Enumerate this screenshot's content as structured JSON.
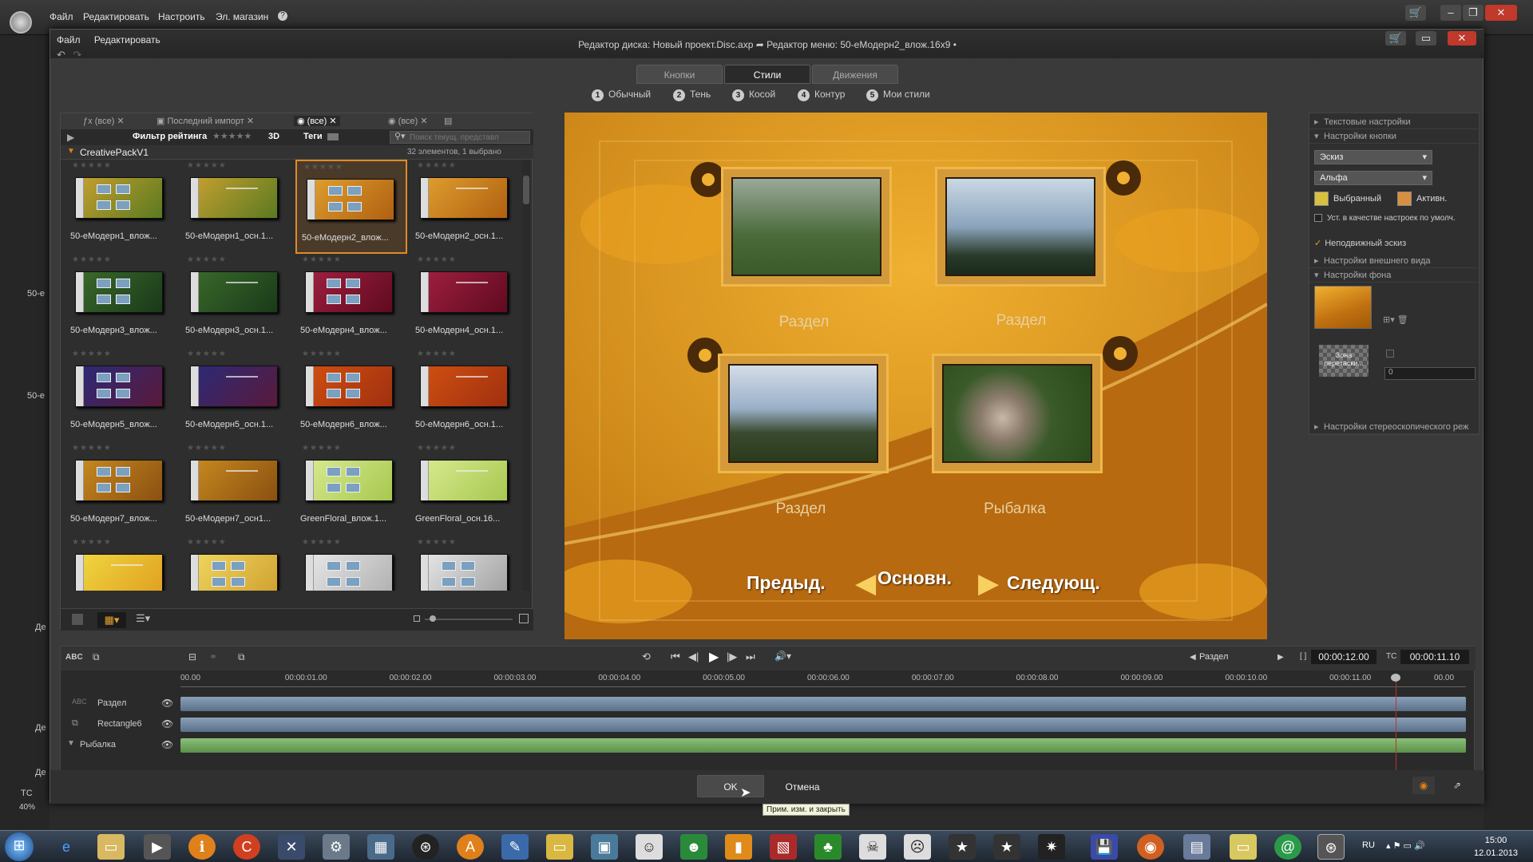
{
  "outer_menu": {
    "file": "Файл",
    "edit": "Редактировать",
    "setup": "Настроить",
    "store": "Эл. магазин",
    "help": "?"
  },
  "dialog": {
    "menu": {
      "file": "Файл",
      "edit": "Редактировать"
    },
    "caption": "Редактор диска: Новый проект.Disc.axp  ➦  Редактор меню: 50-еМодерн2_влож.16х9  •",
    "tabs": [
      "Кнопки",
      "Стили",
      "Движения"
    ],
    "active_tab": "Стили",
    "styles": [
      {
        "num": "1",
        "label": "Обычный"
      },
      {
        "num": "2",
        "label": "Тень"
      },
      {
        "num": "3",
        "label": "Косой"
      },
      {
        "num": "4",
        "label": "Контур"
      },
      {
        "num": "5",
        "label": "Мои стили"
      }
    ]
  },
  "browser": {
    "tabs": [
      "(все)",
      "Последний импорт",
      "(все)",
      "(все)"
    ],
    "filter_label": "Фильтр рейтинга",
    "filter_3d": "3D",
    "filter_tags": "Теги",
    "search_placeholder": "Поиск текущ. представл",
    "group_name": "CreativePackV1",
    "group_count": "32 элементов, 1 выбрано",
    "items": [
      {
        "label": "50-еМодерн1_влож...",
        "color1": "#c8a030",
        "color2": "#5a7a20",
        "type": "grid"
      },
      {
        "label": "50-еМодерн1_осн.1...",
        "color1": "#c8a030",
        "color2": "#5a7a20",
        "type": "text"
      },
      {
        "label": "50-еМодерн2_влож...",
        "color1": "#e0a030",
        "color2": "#b06010",
        "type": "grid"
      },
      {
        "label": "50-еМодерн2_осн.1...",
        "color1": "#e0a030",
        "color2": "#b06010",
        "type": "text"
      },
      {
        "label": "50-еМодерн3_влож...",
        "color1": "#3a6a2a",
        "color2": "#1a3a1a",
        "type": "grid"
      },
      {
        "label": "50-еМодерн3_осн.1...",
        "color1": "#3a6a2a",
        "color2": "#1a3a1a",
        "type": "text"
      },
      {
        "label": "50-еМодерн4_влож...",
        "color1": "#a02040",
        "color2": "#600a20",
        "type": "grid"
      },
      {
        "label": "50-еМодерн4_осн.1...",
        "color1": "#a02040",
        "color2": "#600a20",
        "type": "text"
      },
      {
        "label": "50-еМодерн5_влож...",
        "color1": "#2a2a7a",
        "color2": "#5a1a3a",
        "type": "grid"
      },
      {
        "label": "50-еМодерн5_осн.1...",
        "color1": "#2a2a7a",
        "color2": "#5a1a3a",
        "type": "text"
      },
      {
        "label": "50-еМодерн6_влож...",
        "color1": "#d05010",
        "color2": "#a03010",
        "type": "grid"
      },
      {
        "label": "50-еМодерн6_осн.1...",
        "color1": "#d05010",
        "color2": "#a03010",
        "type": "text"
      },
      {
        "label": "50-еМодерн7_влож...",
        "color1": "#c88a20",
        "color2": "#8a5010",
        "type": "grid"
      },
      {
        "label": "50-еМодерн7_осн1...",
        "color1": "#c88a20",
        "color2": "#8a5010",
        "type": "text"
      },
      {
        "label": "GreenFloral_влож.1...",
        "color1": "#d8ea90",
        "color2": "#a8c850",
        "type": "grid"
      },
      {
        "label": "GreenFloral_осн.16...",
        "color1": "#d8ea90",
        "color2": "#a8c850",
        "type": "text"
      },
      {
        "label": "",
        "color1": "#f0d840",
        "color2": "#e0a020",
        "type": "text"
      },
      {
        "label": "",
        "color1": "#f0d860",
        "color2": "#d0a030",
        "type": "grid"
      },
      {
        "label": "",
        "color1": "#e8e8e8",
        "color2": "#b0b0b0",
        "type": "grid"
      },
      {
        "label": "",
        "color1": "#e8e8e8",
        "color2": "#a0a0a0",
        "type": "grid"
      }
    ]
  },
  "preview": {
    "sections": [
      "Раздел",
      "Раздел",
      "Раздел",
      "Рыбалка"
    ],
    "nav": {
      "prev": "Предыд.",
      "main": "Основн.",
      "next": "Следующ."
    }
  },
  "right_panel": {
    "text_settings": "Текстовые настройки",
    "button_settings": "Настройки кнопки",
    "select1": "Эскиз",
    "select2": "Альфа",
    "selected": "Выбранный",
    "active": "Активн.",
    "default_checkbox": "Уст. в качестве настроек по умолч.",
    "static_thumb": "Неподвижный эскиз",
    "appearance": "Настройки внешнего вида",
    "background": "Настройки фона",
    "drop_zone": "Зона перетаски...",
    "value_field": "0",
    "stereo": "Настройки стереоскопического реж"
  },
  "timeline": {
    "chapter_label": "Раздел",
    "duration_label": "00:00:12.00",
    "tc_prefix": "TC",
    "tc_value": "00:00:11.10",
    "ticks": [
      "00.00",
      "00:00:01.00",
      "00:00:02.00",
      "00:00:03.00",
      "00:00:04.00",
      "00:00:05.00",
      "00:00:06.00",
      "00:00:07.00",
      "00:00:08.00",
      "00:00:09.00",
      "00:00:10.00",
      "00:00:11.00",
      "00.00"
    ],
    "tracks": [
      "Раздел",
      "Rectangle6",
      "Рыбалка"
    ]
  },
  "buttons": {
    "ok": "OK",
    "cancel": "Отмена"
  },
  "tooltip": "Прим. изм. и закрыть",
  "left_strip": {
    "label_a": "50-е",
    "label_b": "50-е",
    "label_c": "Де",
    "label_d": "Де",
    "label_e": "Де",
    "tc": "TC",
    "zoom": "40%"
  },
  "taskbar": {
    "lang": "RU",
    "time": "15:00",
    "date": "12.01.2013"
  }
}
